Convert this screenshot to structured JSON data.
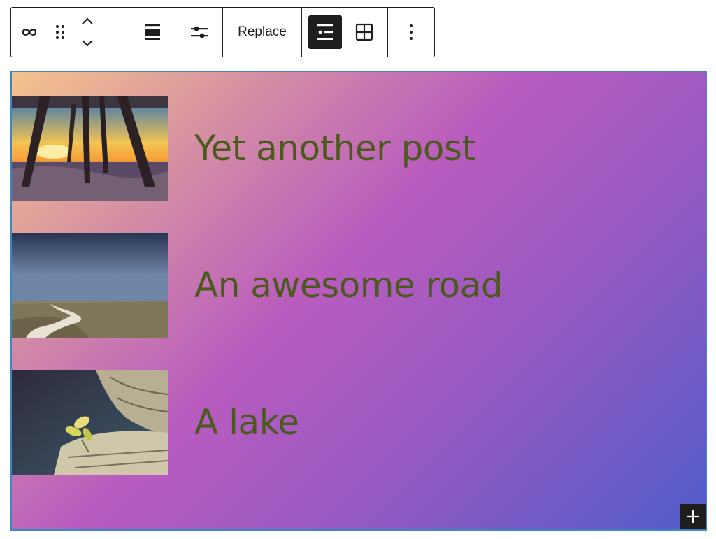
{
  "toolbar": {
    "icons": {
      "block_type": "link-loop-icon",
      "drag": "drag-handle-icon",
      "move_up": "chevron-up-icon",
      "move_down": "chevron-down-icon",
      "align": "align-wide-icon",
      "settings": "sliders-icon",
      "list_view": "list-view-icon",
      "grid_view": "grid-view-icon",
      "more": "more-vertical-icon"
    },
    "replace_label": "Replace",
    "active_view": "list"
  },
  "cover": {
    "gradient_colors": [
      "#f6c38c",
      "#d58fa3",
      "#b95bbf",
      "#8f5ac3",
      "#4f5cc9"
    ],
    "border_color": "#3d86c6",
    "posts": [
      {
        "title": "Yet another post",
        "image": "pier-sunset-photo"
      },
      {
        "title": "An awesome road",
        "image": "country-road-photo"
      },
      {
        "title": "A lake",
        "image": "plant-on-log-photo"
      }
    ],
    "title_color": "#4a5a1c"
  },
  "add_block": {
    "icon": "plus-icon"
  }
}
